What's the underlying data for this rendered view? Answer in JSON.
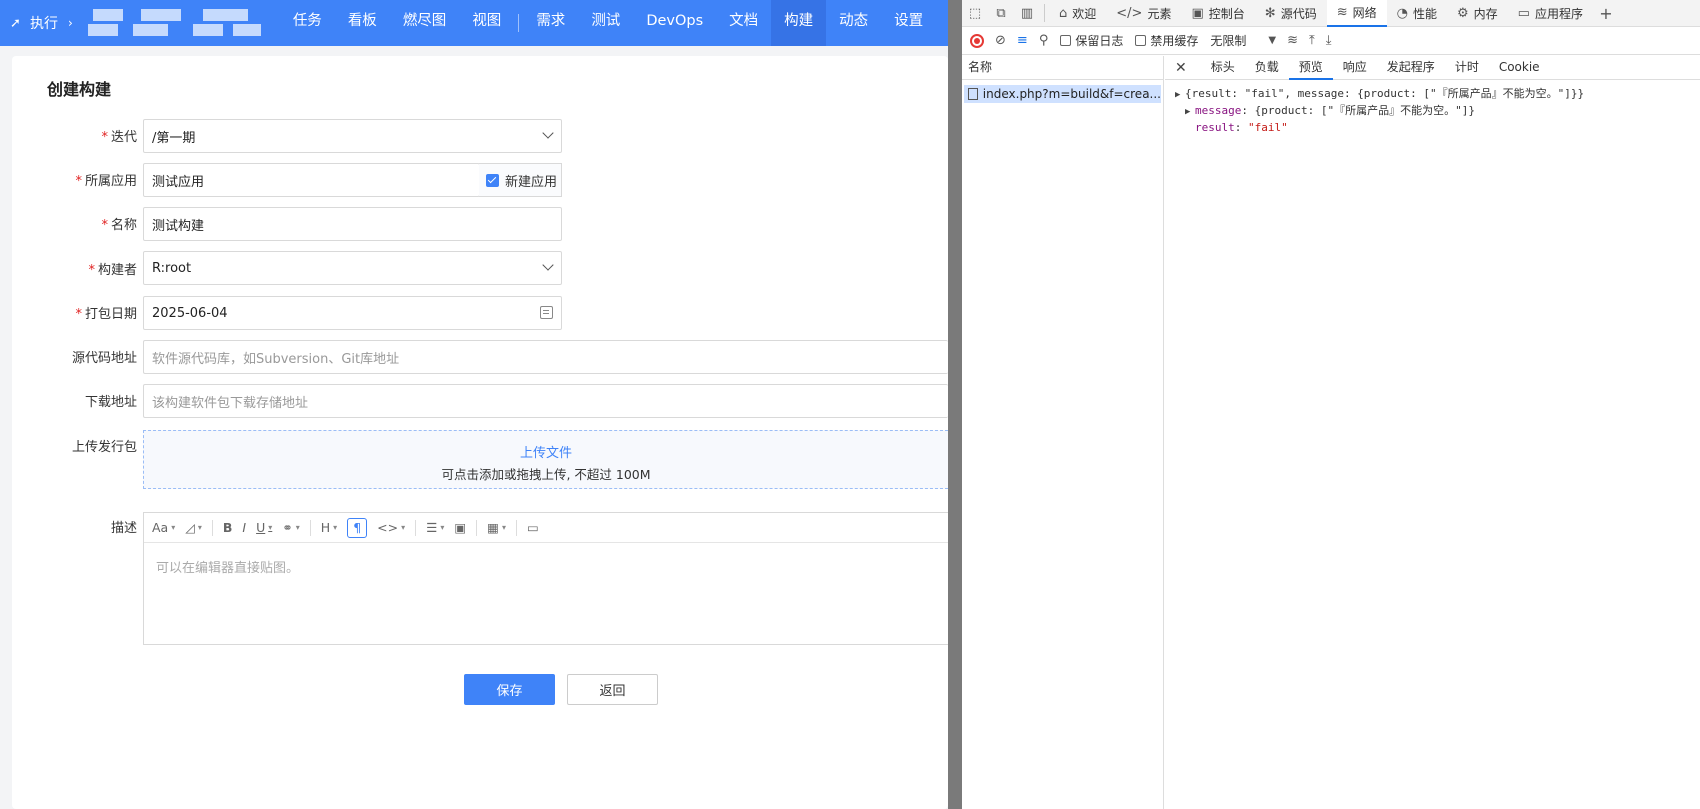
{
  "app": {
    "nav": {
      "exec_label": "执行",
      "items": [
        {
          "label": "任务"
        },
        {
          "label": "看板"
        },
        {
          "label": "燃尽图"
        },
        {
          "label": "视图"
        },
        {
          "label": "需求"
        },
        {
          "label": "测试"
        },
        {
          "label": "DevOps"
        },
        {
          "label": "文档"
        },
        {
          "label": "构建",
          "active": true
        },
        {
          "label": "动态"
        },
        {
          "label": "设置"
        }
      ]
    },
    "page_title": "创建构建",
    "form": {
      "iteration": {
        "label": "迭代",
        "value": "/第一期"
      },
      "app": {
        "label": "所属应用",
        "value": "测试应用",
        "new_app_label": "新建应用"
      },
      "name": {
        "label": "名称",
        "value": "测试构建"
      },
      "builder": {
        "label": "构建者",
        "value": "R:root"
      },
      "date": {
        "label": "打包日期",
        "value": "2025-06-04"
      },
      "source": {
        "label": "源代码地址",
        "placeholder": "软件源代码库，如Subversion、Git库地址"
      },
      "download": {
        "label": "下载地址",
        "placeholder": "该构建软件包下载存储地址"
      },
      "upload": {
        "label": "上传发行包",
        "link": "上传文件",
        "hint": "可点击添加或拖拽上传, 不超过 100M"
      },
      "desc": {
        "label": "描述",
        "placeholder": "可以在编辑器直接贴图。"
      }
    },
    "buttons": {
      "save": "保存",
      "back": "返回"
    }
  },
  "devtools": {
    "tabs": [
      {
        "label": "欢迎"
      },
      {
        "label": "元素"
      },
      {
        "label": "控制台"
      },
      {
        "label": "源代码"
      },
      {
        "label": "网络",
        "active": true
      },
      {
        "label": "性能"
      },
      {
        "label": "内存"
      },
      {
        "label": "应用程序"
      }
    ],
    "toolbar": {
      "preserve_log": "保留日志",
      "disable_cache": "禁用缓存",
      "throttle": "无限制"
    },
    "names_header": "名称",
    "request": "index.php?m=build&f=crea...",
    "detail_tabs": [
      {
        "label": "标头"
      },
      {
        "label": "负载"
      },
      {
        "label": "预览",
        "active": true
      },
      {
        "label": "响应"
      },
      {
        "label": "发起程序"
      },
      {
        "label": "计时"
      },
      {
        "label": "Cookie"
      }
    ],
    "json": {
      "line1": "{result: \"fail\", message: {product: [\"『所属产品』不能为空。\"]}}",
      "message_key": "message",
      "message_val": "{product: [\"『所属产品』不能为空。\"]}",
      "result_key": "result",
      "result_val": "\"fail\""
    }
  }
}
